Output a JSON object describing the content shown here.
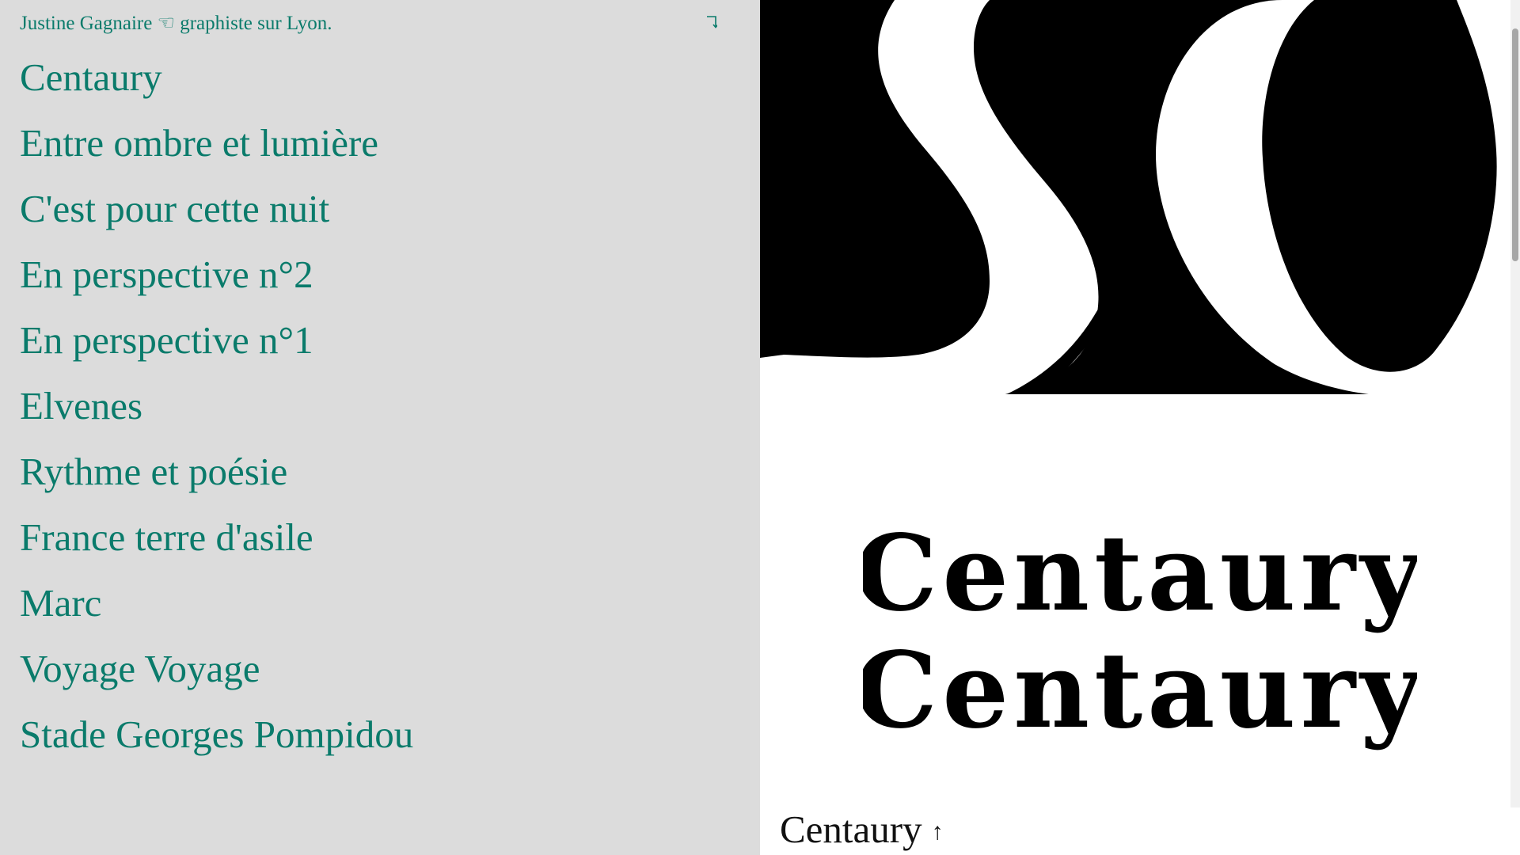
{
  "header": {
    "intro": "Justine Gagnaire ☜ graphiste sur Lyon.",
    "corner_icon": "corner-arrow-icon"
  },
  "projects": [
    "Centaury",
    "Entre ombre et lumière",
    "C'est pour cette nuit",
    "En perspective n°2",
    "En perspective n°1",
    "Elvenes",
    "Rythme et poésie",
    "France terre d'asile",
    "Marc",
    "Voyage Voyage",
    "Stade Georges Pompidou"
  ],
  "preview": {
    "specimen_line_1": "Centaury",
    "specimen_line_2": "Centaury",
    "caption": "Centaury",
    "caption_arrow": "↑"
  },
  "colors": {
    "left_background": "#dcdcdc",
    "accent_text": "#0a7b6b",
    "right_background": "#ffffff",
    "art_black": "#000000"
  }
}
